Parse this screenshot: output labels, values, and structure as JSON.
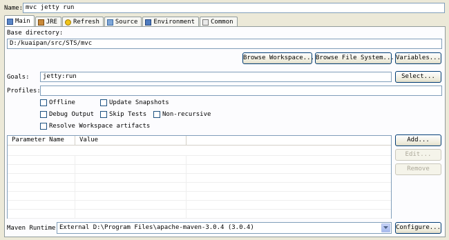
{
  "name": {
    "label": "Name:",
    "value": "mvc jetty run"
  },
  "tabs": [
    {
      "label": "Main",
      "icon": "main-icon"
    },
    {
      "label": "JRE",
      "icon": "jre-icon"
    },
    {
      "label": "Refresh",
      "icon": "refresh-icon"
    },
    {
      "label": "Source",
      "icon": "source-icon"
    },
    {
      "label": "Environment",
      "icon": "environment-icon"
    },
    {
      "label": "Common",
      "icon": "common-icon"
    }
  ],
  "base_directory": {
    "label": "Base directory:",
    "value": "D:/kuaipan/src/STS/mvc"
  },
  "buttons": {
    "browse_workspace": "Browse Workspace...",
    "browse_file_system": "Browse File System...",
    "variables": "Variables...",
    "select": "Select...",
    "add": "Add...",
    "edit": "Edit...",
    "remove": "Remove",
    "configure": "Configure..."
  },
  "goals": {
    "label": "Goals:",
    "value": "jetty:run"
  },
  "profiles": {
    "label": "Profiles:",
    "value": ""
  },
  "options": {
    "offline": "Offline",
    "update_snapshots": "Update Snapshots",
    "debug_output": "Debug Output",
    "skip_tests": "Skip Tests",
    "non_recursive": "Non-recursive",
    "resolve_workspace": "Resolve Workspace artifacts"
  },
  "parameters_table": {
    "columns": [
      "Parameter Name",
      "Value"
    ]
  },
  "maven_runtime": {
    "label": "Maven Runtime:",
    "value": "External D:\\Program Files\\apache-maven-3.0.4 (3.0.4)"
  },
  "colors": {
    "background": "#ece9d8",
    "field_border": "#7f9db9",
    "button_border": "#003c74"
  }
}
